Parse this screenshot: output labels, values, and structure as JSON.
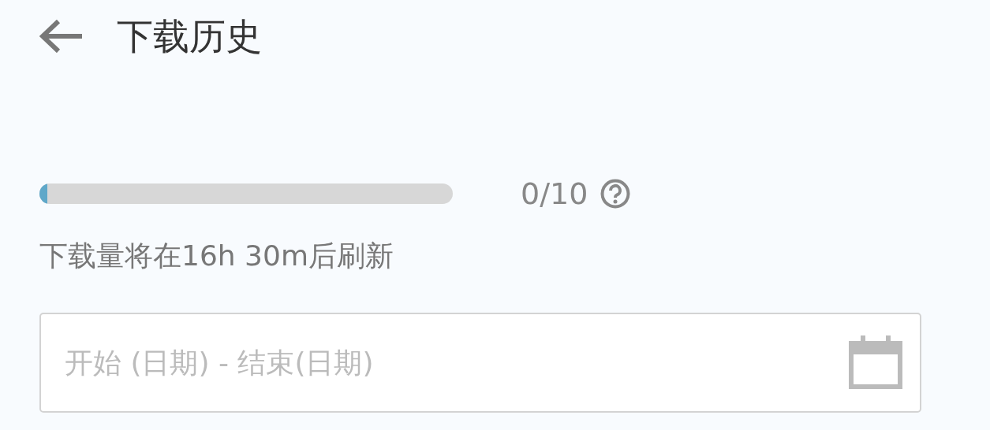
{
  "header": {
    "title": "下载历史"
  },
  "quota": {
    "level": 0.02,
    "reading": "0/10",
    "note": "下载量将在16h 30m后刷新"
  },
  "date_range": {
    "placeholder": "开始 (日期) - 结束(日期)"
  }
}
